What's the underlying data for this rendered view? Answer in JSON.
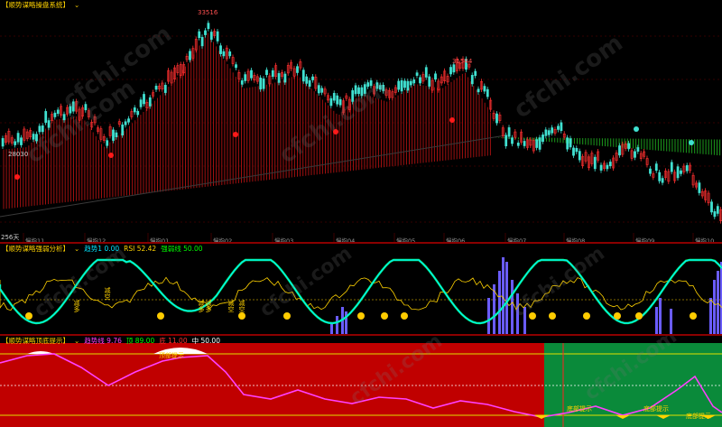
{
  "panel1": {
    "title": "【顺势谋略操盘系统】",
    "high_label": "33516",
    "mid_high_label": "31544",
    "low_label": "28030",
    "day_count_label": "256天",
    "dates": [
      "慢指11",
      "慢指12",
      "慢指01",
      "慢指02",
      "慢指03",
      "慢指04",
      "慢指05",
      "慢指06",
      "慢指07",
      "慢指08",
      "慢指09",
      "慢指10"
    ]
  },
  "panel2": {
    "title": "【顺势谋略强弱分析】",
    "legend": [
      {
        "label": "趋势1 0.00",
        "color": "#00e5ff"
      },
      {
        "label": "RSI 52.42",
        "color": "#ffd200"
      },
      {
        "label": "强弱线 50.00",
        "color": "#00ff00"
      }
    ],
    "markers": [
      "减多",
      "减空",
      "减多",
      "减多",
      "减空",
      "减空"
    ]
  },
  "panel3": {
    "title": "【顺势谋略顶底提示】",
    "legend": [
      {
        "label": "趋势线 9.76",
        "color": "#ff40ff"
      },
      {
        "label": "顶 89.00",
        "color": "#00ff00"
      },
      {
        "label": "底 11.00",
        "color": "#ff3030"
      },
      {
        "label": "中 50.00",
        "color": "#ffffff"
      }
    ],
    "top_hint": "顶部提示",
    "bottom_hints": [
      "底部提示",
      "底部提示",
      "底部提示"
    ]
  },
  "watermark": "cfchi.com",
  "colors": {
    "up": "#ff3030",
    "down": "#40e0d0",
    "accent": "#ffd200"
  }
}
